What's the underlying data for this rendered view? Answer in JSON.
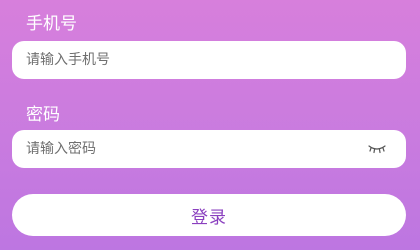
{
  "form": {
    "phone": {
      "label": "手机号",
      "placeholder": "请输入手机号",
      "value": ""
    },
    "password": {
      "label": "密码",
      "placeholder": "请输入密码",
      "value": "",
      "toggle_icon": "eye-closed-icon"
    },
    "submit_label": "登录"
  },
  "colors": {
    "background_top": "#d77fdc",
    "background_bottom": "#bd76e1",
    "button_text": "#8a3fbf"
  }
}
